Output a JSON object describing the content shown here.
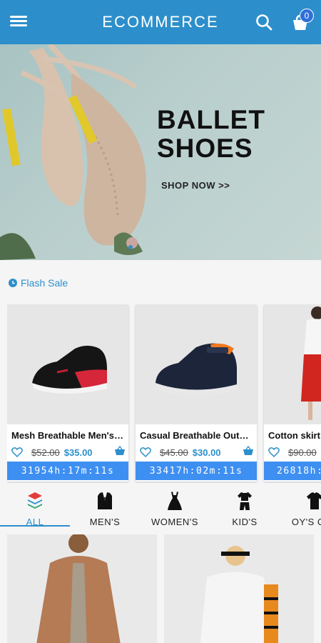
{
  "header": {
    "brand": "ECOMMERCE",
    "cart_count": "0"
  },
  "banner": {
    "title": "BALLET\nSHOES",
    "cta": "SHOP NOW >>"
  },
  "flash_sale": {
    "label": "Flash Sale",
    "items": [
      {
        "title": "Mesh Breathable Men's S...",
        "old_price": "$52.00",
        "new_price": "$35.00",
        "timer": "31954h:17m:11s"
      },
      {
        "title": "Casual Breathable Outdo...",
        "old_price": "$45.00",
        "new_price": "$30.00",
        "timer": "33417h:02m:11s"
      },
      {
        "title": "Cotton skirt",
        "old_price": "$90.00",
        "new_price": "",
        "timer": "26818h:"
      }
    ]
  },
  "categories": [
    {
      "label": "ALL"
    },
    {
      "label": "MEN'S"
    },
    {
      "label": "WOMEN'S"
    },
    {
      "label": "KID'S"
    },
    {
      "label": "OY'S CLO"
    }
  ],
  "colors": {
    "primary": "#2c8fcb",
    "timer_bg": "#3e8ff2"
  }
}
